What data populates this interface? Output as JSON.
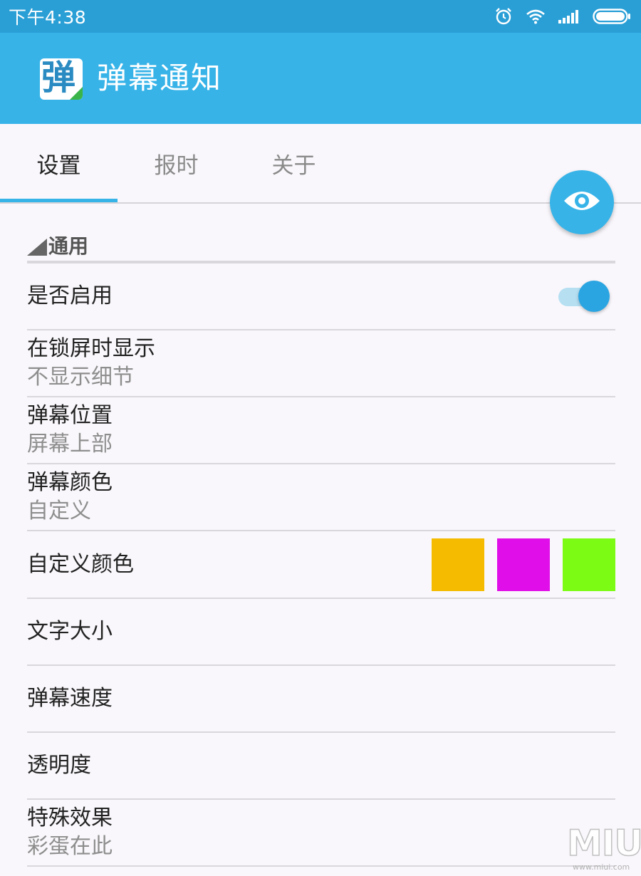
{
  "status_bar": {
    "time": "下午4:38",
    "icons": [
      "alarm-icon",
      "wifi-icon",
      "signal-icon",
      "battery-icon"
    ]
  },
  "app_bar": {
    "logo_char": "弹",
    "title": "弹幕通知"
  },
  "tabs": [
    {
      "label": "设置",
      "active": true
    },
    {
      "label": "报时",
      "active": false
    },
    {
      "label": "关于",
      "active": false
    }
  ],
  "fab": {
    "icon": "eye-icon"
  },
  "section": {
    "title": "通用"
  },
  "settings": {
    "enable": {
      "title": "是否启用",
      "on": true
    },
    "lockscreen": {
      "title": "在锁屏时显示",
      "summary": "不显示细节"
    },
    "position": {
      "title": "弹幕位置",
      "summary": "屏幕上部"
    },
    "color": {
      "title": "弹幕颜色",
      "summary": "自定义"
    },
    "custom_color": {
      "title": "自定义颜色",
      "swatches": [
        "#f5bb00",
        "#e00ee8",
        "#7cfb14"
      ]
    },
    "text_size": {
      "title": "文字大小"
    },
    "speed": {
      "title": "弹幕速度"
    },
    "opacity": {
      "title": "透明度"
    },
    "effects": {
      "title": "特殊效果",
      "summary": "彩蛋在此"
    }
  },
  "watermark": {
    "brand": "MIUI",
    "site": "www.miui.com"
  },
  "colors": {
    "status_bar": "#2a9fd6",
    "app_bar": "#37b3e8",
    "accent": "#37b3e8",
    "background": "#f9f7fb"
  }
}
